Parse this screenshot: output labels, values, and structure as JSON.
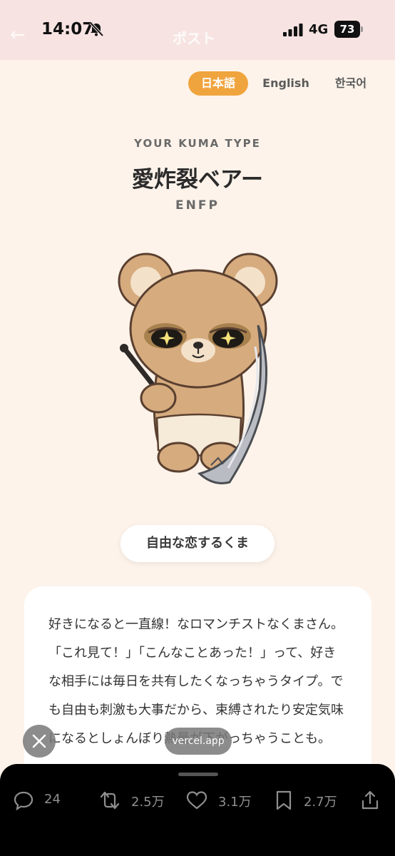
{
  "status_bar": {
    "time": "14:07",
    "network": "4G",
    "battery": "73",
    "background_title": "ポスト"
  },
  "languages": [
    {
      "label": "日本語",
      "active": true
    },
    {
      "label": "English",
      "active": false
    },
    {
      "label": "한국어",
      "active": false
    }
  ],
  "result": {
    "eyebrow": "YOUR KUMA TYPE",
    "title": "愛炸裂ベアー",
    "code": "ENFP",
    "tag": "自由な恋するくま",
    "description": "好きになると一直線！なロマンチストなくまさん。「これ見て！」「こんなことあった！」って、好きな相手には毎日を共有したくなっちゃうタイプ。でも自由も刺激も大事だから、束縛されたり安定気味になるとしょんぼり熱量が下がっちゃうことも。"
  },
  "browser_overlay": {
    "domain": "vercel.app"
  },
  "post_actions": {
    "replies": "24",
    "reposts": "2.5万",
    "likes": "3.1万",
    "bookmarks": "2.7万"
  },
  "colors": {
    "accent": "#f0a43e",
    "page_background": "#fdf3ea",
    "status_bar_background": "#f7e4e2"
  }
}
